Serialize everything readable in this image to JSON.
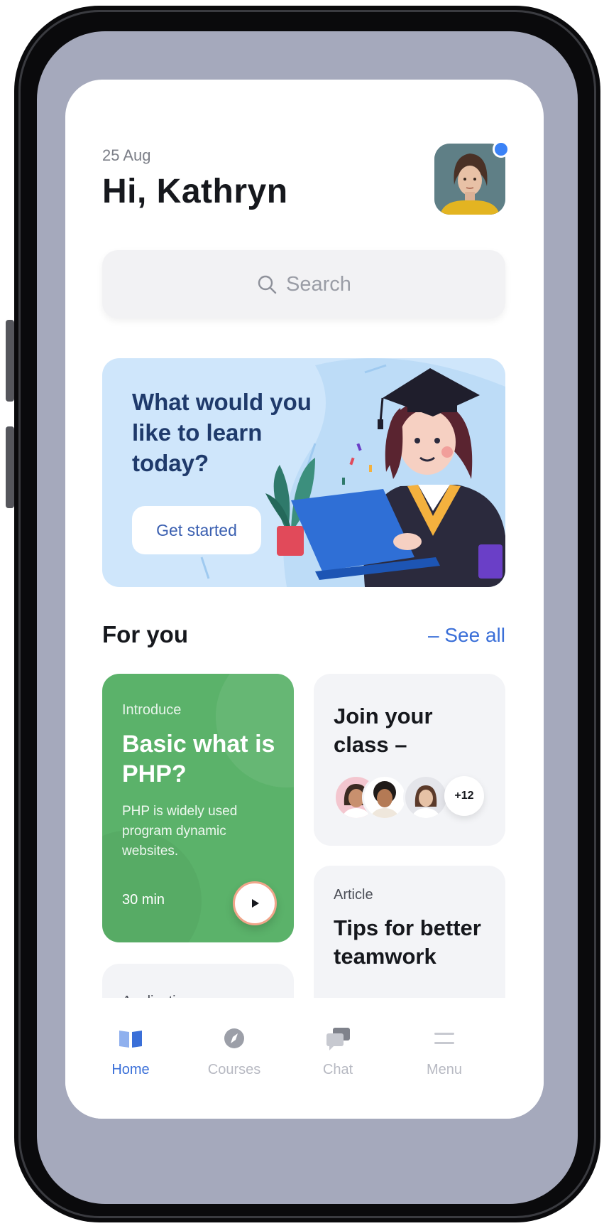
{
  "header": {
    "date": "25 Aug",
    "greeting": "Hi, Kathryn"
  },
  "search": {
    "placeholder": "Search"
  },
  "banner": {
    "title": "What would you like to learn today?",
    "button_label": "Get started"
  },
  "section": {
    "title": "For you",
    "see_all": "– See all"
  },
  "cards": {
    "lesson": {
      "kicker": "Introduce",
      "title": "Basic what is PHP?",
      "description": "PHP is widely used program dynamic websites.",
      "duration": "30 min"
    },
    "application": {
      "label": "Application"
    },
    "join_class": {
      "title": "Join your class –",
      "more_count": "+12"
    },
    "article": {
      "kicker": "Article",
      "title": "Tips for better teamwork"
    }
  },
  "nav": {
    "items": [
      {
        "label": "Home",
        "icon": "book-icon",
        "active": true
      },
      {
        "label": "Courses",
        "icon": "compass-icon",
        "active": false
      },
      {
        "label": "Chat",
        "icon": "chat-icon",
        "active": false
      },
      {
        "label": "Menu",
        "icon": "menu-icon",
        "active": false
      }
    ]
  },
  "colors": {
    "accent": "#3a6fd8",
    "lesson_card": "#5bb26a",
    "banner_bg": "#cfe6fb",
    "notification_dot": "#3b82f6"
  }
}
